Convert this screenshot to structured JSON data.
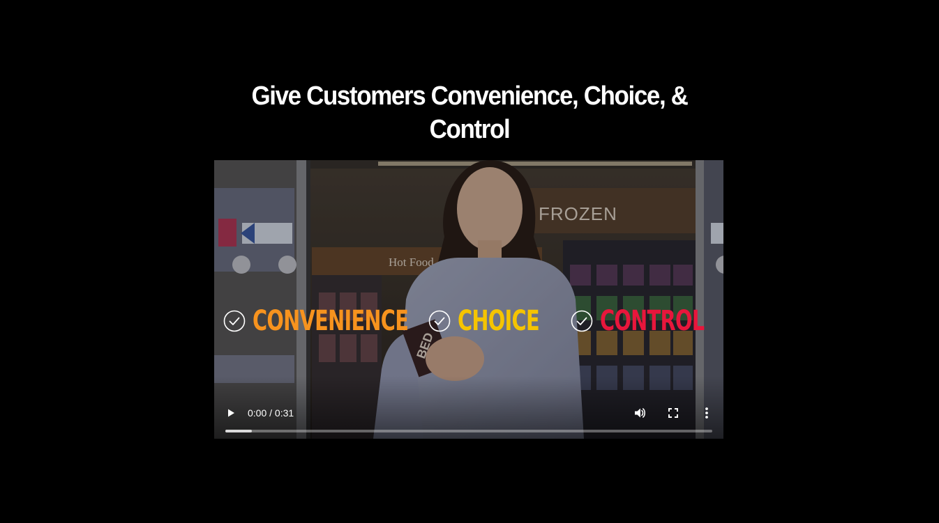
{
  "heading": "Give Customers Convenience, Choice, & Control",
  "video": {
    "scene_sign_text": "FROZEN",
    "scene_counter_text": "Hot Food",
    "scene_bag_text": "BED",
    "features": [
      {
        "label": "CONVENIENCE",
        "color": "#f7931e",
        "icon": "check-circle-icon"
      },
      {
        "label": "CHOICE",
        "color": "#f5c400",
        "icon": "check-circle-icon"
      },
      {
        "label": "CONTROL",
        "color": "#e8163c",
        "icon": "check-circle-icon"
      }
    ],
    "player": {
      "current_time": "0:00",
      "duration": "0:31",
      "time_display": "0:00 / 0:31",
      "buffered_fraction": 0.055,
      "play_icon": "play-icon",
      "volume_icon": "volume-icon",
      "fullscreen_icon": "fullscreen-icon",
      "more_icon": "more-options-icon"
    }
  }
}
